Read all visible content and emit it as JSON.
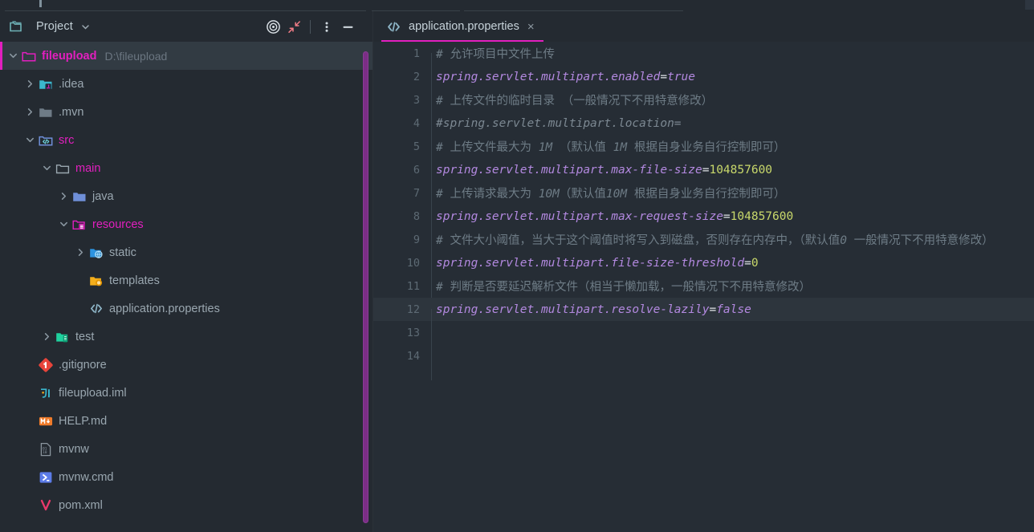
{
  "window": {
    "accent_magenta": "#E21FBF",
    "bg": "#242A31",
    "editor_bg": "#262D35"
  },
  "project_panel": {
    "title": "Project",
    "title_chevron": "chevron-down",
    "toolbar": [
      {
        "name": "select-opened-file-icon",
        "label": "target-icon"
      },
      {
        "name": "collapse-all-icon",
        "label": "collapse-all"
      },
      {
        "name": "options-menu-icon",
        "label": "more-vertical"
      },
      {
        "name": "hide-panel-icon",
        "label": "minimize"
      }
    ],
    "tree": [
      {
        "label": "fileupload",
        "sub": "D:\\fileupload",
        "icon": "folder-module-icon",
        "indent": 0,
        "arrow": "expanded",
        "style": "accent-bold",
        "selected": true
      },
      {
        "label": ".idea",
        "sub": "",
        "icon": "folder-idea-icon",
        "indent": 1,
        "arrow": "collapsed",
        "style": "plain",
        "selected": false
      },
      {
        "label": ".mvn",
        "sub": "",
        "icon": "folder-gray-icon",
        "indent": 1,
        "arrow": "collapsed",
        "style": "plain",
        "selected": false
      },
      {
        "label": "src",
        "sub": "",
        "icon": "folder-source-root-icon",
        "indent": 1,
        "arrow": "expanded",
        "style": "accent",
        "selected": false
      },
      {
        "label": "main",
        "sub": "",
        "icon": "folder-outline-icon",
        "indent": 2,
        "arrow": "expanded",
        "style": "accent",
        "selected": false
      },
      {
        "label": "java",
        "sub": "",
        "icon": "folder-java-icon",
        "indent": 3,
        "arrow": "collapsed",
        "style": "plain",
        "selected": false
      },
      {
        "label": "resources",
        "sub": "",
        "icon": "folder-resources-icon",
        "indent": 3,
        "arrow": "expanded",
        "style": "accent",
        "selected": false
      },
      {
        "label": "static",
        "sub": "",
        "icon": "folder-web-icon",
        "indent": 4,
        "arrow": "collapsed",
        "style": "plain",
        "selected": false
      },
      {
        "label": "templates",
        "sub": "",
        "icon": "folder-templates-icon",
        "indent": 4,
        "arrow": "blank",
        "style": "plain",
        "selected": false
      },
      {
        "label": "application.properties",
        "sub": "",
        "icon": "properties-file-icon",
        "indent": 4,
        "arrow": "blank",
        "style": "plain",
        "selected": false
      },
      {
        "label": "test",
        "sub": "",
        "icon": "folder-test-root-icon",
        "indent": 2,
        "arrow": "collapsed",
        "style": "plain",
        "selected": false
      },
      {
        "label": ".gitignore",
        "sub": "",
        "icon": "git-file-icon",
        "indent": 1,
        "arrow": "blank",
        "style": "plain",
        "selected": false
      },
      {
        "label": "fileupload.iml",
        "sub": "",
        "icon": "iml-file-icon",
        "indent": 1,
        "arrow": "blank",
        "style": "plain",
        "selected": false
      },
      {
        "label": "HELP.md",
        "sub": "",
        "icon": "markdown-file-icon",
        "indent": 1,
        "arrow": "blank",
        "style": "plain",
        "selected": false
      },
      {
        "label": "mvnw",
        "sub": "",
        "icon": "binary-file-icon",
        "indent": 1,
        "arrow": "blank",
        "style": "plain",
        "selected": false
      },
      {
        "label": "mvnw.cmd",
        "sub": "",
        "icon": "cmd-file-icon",
        "indent": 1,
        "arrow": "blank",
        "style": "plain",
        "selected": false
      },
      {
        "label": "pom.xml",
        "sub": "",
        "icon": "maven-file-icon",
        "indent": 1,
        "arrow": "blank",
        "style": "plain",
        "selected": false
      }
    ]
  },
  "editor": {
    "tab": {
      "label": "application.properties",
      "icon": "properties-file-icon",
      "close": "×"
    },
    "current_line": 12,
    "lines": [
      {
        "n": "1",
        "segments": [
          {
            "t": "# 允许项目中文件上传",
            "c": "cm"
          }
        ]
      },
      {
        "n": "2",
        "segments": [
          {
            "t": "spring.servlet.multipart.enabled",
            "c": "key"
          },
          {
            "t": "=",
            "c": "eq"
          },
          {
            "t": "true",
            "c": "val-s"
          }
        ]
      },
      {
        "n": "3",
        "segments": [
          {
            "t": "# 上传文件的临时目录 （一般情况下不用特意修改）",
            "c": "cm"
          }
        ]
      },
      {
        "n": "4",
        "segments": [
          {
            "t": "#spring.servlet.multipart.location=",
            "c": "cm-dis"
          }
        ]
      },
      {
        "n": "5",
        "segments": [
          {
            "t": "# 上传文件最大为 ",
            "c": "cm"
          },
          {
            "t": "1M",
            "c": "cm-i"
          },
          {
            "t": " （默认值 ",
            "c": "cm"
          },
          {
            "t": "1M",
            "c": "cm-i"
          },
          {
            "t": " 根据自身业务自行控制即可）",
            "c": "cm"
          }
        ]
      },
      {
        "n": "6",
        "segments": [
          {
            "t": "spring.servlet.multipart.max-file-size",
            "c": "key"
          },
          {
            "t": "=",
            "c": "eq"
          },
          {
            "t": "104857600",
            "c": "val-n"
          }
        ]
      },
      {
        "n": "7",
        "segments": [
          {
            "t": "# 上传请求最大为 ",
            "c": "cm"
          },
          {
            "t": "10M",
            "c": "cm-i"
          },
          {
            "t": "（默认值",
            "c": "cm"
          },
          {
            "t": "10M",
            "c": "cm-i"
          },
          {
            "t": " 根据自身业务自行控制即可）",
            "c": "cm"
          }
        ]
      },
      {
        "n": "8",
        "segments": [
          {
            "t": "spring.servlet.multipart.max-request-size",
            "c": "key"
          },
          {
            "t": "=",
            "c": "eq"
          },
          {
            "t": "104857600",
            "c": "val-n"
          }
        ]
      },
      {
        "n": "9",
        "segments": [
          {
            "t": "# 文件大小阈值，当大于这个阈值时将写入到磁盘，否则存在内存中，（默认值",
            "c": "cm"
          },
          {
            "t": "0",
            "c": "cm-i"
          },
          {
            "t": " 一般情况下不用特意修改）",
            "c": "cm"
          }
        ]
      },
      {
        "n": "10",
        "segments": [
          {
            "t": "spring.servlet.multipart.file-size-threshold",
            "c": "key"
          },
          {
            "t": "=",
            "c": "eq"
          },
          {
            "t": "0",
            "c": "val-n"
          }
        ]
      },
      {
        "n": "11",
        "segments": [
          {
            "t": "# 判断是否要延迟解析文件（相当于懒加载，一般情况下不用特意修改）",
            "c": "cm"
          }
        ]
      },
      {
        "n": "12",
        "segments": [
          {
            "t": "spring.servlet.multipart.resolve-lazily",
            "c": "key"
          },
          {
            "t": "=",
            "c": "eq"
          },
          {
            "t": "false",
            "c": "val-s"
          }
        ]
      },
      {
        "n": "13",
        "segments": []
      },
      {
        "n": "14",
        "segments": []
      }
    ]
  }
}
